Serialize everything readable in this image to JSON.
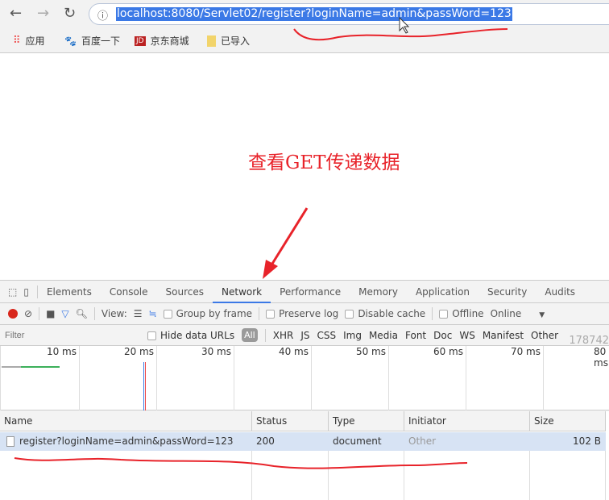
{
  "browser": {
    "url": "localhost:8080/Servlet02/register?loginName=admin&passWord=123",
    "bookmarks": [
      {
        "label": "应用",
        "icon": "apps-grid-icon"
      },
      {
        "label": "百度一下",
        "icon": "baidu-paw-icon"
      },
      {
        "label": "京东商城",
        "icon": "jd-logo-icon"
      },
      {
        "label": "已导入",
        "icon": "folder-icon"
      }
    ]
  },
  "annotation": {
    "text": "查看GET传递数据",
    "color": "#e8232a"
  },
  "devtools": {
    "tabs": [
      "Elements",
      "Console",
      "Sources",
      "Network",
      "Performance",
      "Memory",
      "Application",
      "Security",
      "Audits"
    ],
    "active_tab": "Network",
    "toolbar": {
      "view_label": "View:",
      "group_by_frame": "Group by frame",
      "preserve_log": "Preserve log",
      "disable_cache": "Disable cache",
      "offline": "Offline",
      "throttle": "Online"
    },
    "filter": {
      "placeholder": "Filter",
      "hide_data_urls": "Hide data URLs",
      "types": [
        "All",
        "XHR",
        "JS",
        "CSS",
        "Img",
        "Media",
        "Font",
        "Doc",
        "WS",
        "Manifest",
        "Other"
      ]
    },
    "watermark": "178742",
    "timeline": {
      "ticks": [
        "10 ms",
        "20 ms",
        "30 ms",
        "40 ms",
        "50 ms",
        "60 ms",
        "70 ms",
        "80 ms"
      ]
    },
    "table": {
      "columns": [
        "Name",
        "Status",
        "Type",
        "Initiator",
        "Size"
      ],
      "rows": [
        {
          "name": "register?loginName=admin&passWord=123",
          "status": "200",
          "type": "document",
          "initiator": "Other",
          "size": "102 B"
        }
      ]
    }
  }
}
